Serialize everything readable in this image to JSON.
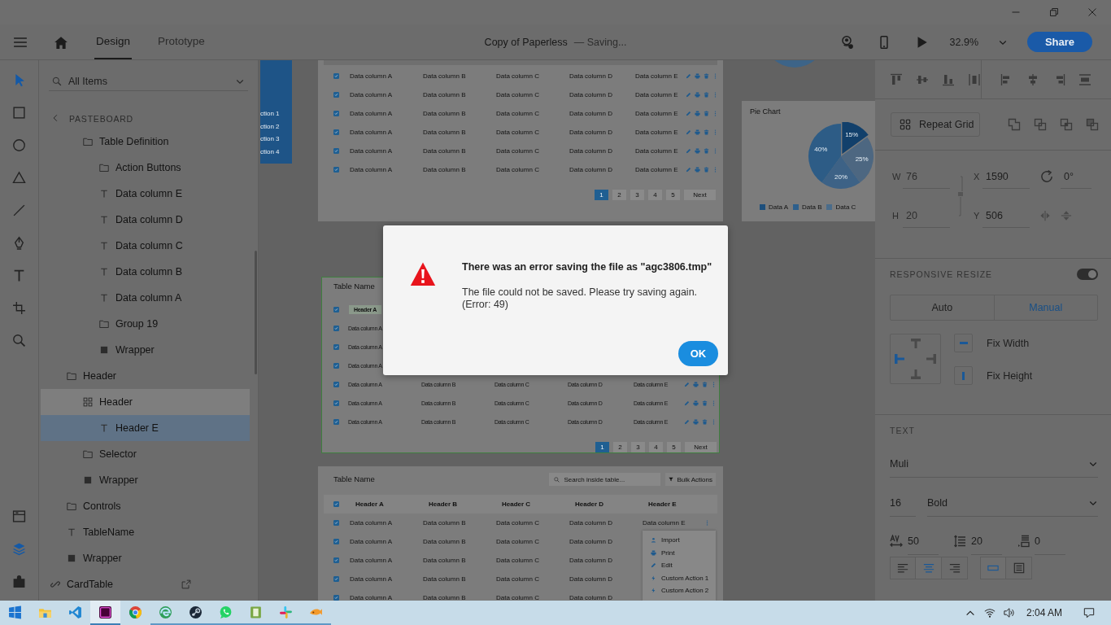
{
  "window": {
    "controls": [
      {
        "kind": "minimize"
      },
      {
        "kind": "restore"
      },
      {
        "kind": "close"
      }
    ]
  },
  "toolbar": {
    "tabs": [
      {
        "label": "Design",
        "selected": true
      },
      {
        "label": "Prototype",
        "selected": false
      }
    ],
    "document_title": "Copy of Paperless",
    "save_status": "— Saving...",
    "zoom": "32.9%",
    "share": "Share"
  },
  "tools": [
    {
      "kind": "select",
      "selected": true
    },
    {
      "kind": "rectangle",
      "selected": false
    },
    {
      "kind": "ellipse",
      "selected": false
    },
    {
      "kind": "polygon",
      "selected": false
    },
    {
      "kind": "line",
      "selected": false
    },
    {
      "kind": "pen",
      "selected": false
    },
    {
      "kind": "text",
      "selected": false
    },
    {
      "kind": "artboard",
      "selected": false
    },
    {
      "kind": "zoom",
      "selected": false
    }
  ],
  "panel_switch": [
    {
      "kind": "assets",
      "selected": false
    },
    {
      "kind": "layers",
      "selected": true
    },
    {
      "kind": "plugins",
      "selected": false
    }
  ],
  "layers": {
    "filter": {
      "placeholder": "All Items"
    },
    "breadcrumb": "PASTEBOARD",
    "tree": [
      {
        "children": [
          {
            "children": [
              {
                "label": "Table Definition",
                "kind": "folder",
                "selected": false,
                "hovered": false,
                "children": [
                  {
                    "label": "Action Buttons",
                    "kind": "folder",
                    "selected": false,
                    "hovered": false
                  },
                  {
                    "label": "Data column E",
                    "kind": "text",
                    "selected": false,
                    "hovered": false
                  },
                  {
                    "label": "Data column D",
                    "kind": "text",
                    "selected": false,
                    "hovered": false
                  },
                  {
                    "label": "Data column C",
                    "kind": "text",
                    "selected": false,
                    "hovered": false
                  },
                  {
                    "label": "Data column B",
                    "kind": "text",
                    "selected": false,
                    "hovered": false
                  },
                  {
                    "label": "Data column A",
                    "kind": "text",
                    "selected": false,
                    "hovered": false
                  },
                  {
                    "label": "Group 19",
                    "kind": "folder",
                    "selected": false,
                    "hovered": false
                  },
                  {
                    "label": "Wrapper",
                    "kind": "shape",
                    "selected": false,
                    "hovered": false
                  }
                ]
              }
            ]
          },
          {
            "label": "Header",
            "kind": "folder",
            "selected": false,
            "hovered": false,
            "children": [
              {
                "label": "Header",
                "kind": "grid",
                "selected": false,
                "hovered": true,
                "children": [
                  {
                    "label": "Header E",
                    "kind": "text",
                    "selected": true,
                    "hovered": false
                  }
                ]
              },
              {
                "label": "Selector",
                "kind": "folder",
                "selected": false,
                "hovered": false
              },
              {
                "label": "Wrapper",
                "kind": "shape",
                "selected": false,
                "hovered": false
              }
            ]
          },
          {
            "label": "Controls",
            "kind": "folder",
            "selected": false,
            "hovered": false
          },
          {
            "label": "TableName",
            "kind": "text",
            "selected": false,
            "hovered": false
          },
          {
            "label": "Wrapper",
            "kind": "shape",
            "selected": false,
            "hovered": false
          }
        ]
      },
      {
        "label": "CardTable",
        "kind": "component",
        "selected": false,
        "hovered": false,
        "linked": true
      }
    ]
  },
  "canvas": {
    "nav_artboard": {
      "items": [
        "ction 1",
        "ction 2",
        "ction 3",
        "ction 4"
      ]
    },
    "tables": [
      {
        "frame_selected": false,
        "rows": [
          {
            "kind": "actions",
            "checked": true,
            "cells": [
              "Data column A",
              "Data column B",
              "Data column C",
              "Data column D",
              "Data column E"
            ]
          },
          {
            "kind": "actions",
            "checked": true,
            "cells": [
              "Data column A",
              "Data column B",
              "Data column C",
              "Data column D",
              "Data column E"
            ]
          },
          {
            "kind": "actions",
            "checked": true,
            "cells": [
              "Data column A",
              "Data column B",
              "Data column C",
              "Data column D",
              "Data column E"
            ]
          },
          {
            "kind": "actions",
            "checked": true,
            "cells": [
              "Data column A",
              "Data column B",
              "Data column C",
              "Data column D",
              "Data column E"
            ]
          },
          {
            "kind": "actions",
            "checked": true,
            "cells": [
              "Data column A",
              "Data column B",
              "Data column C",
              "Data column D",
              "Data column E"
            ]
          },
          {
            "kind": "actions",
            "checked": true,
            "cells": [
              "Data column A",
              "Data column B",
              "Data column C",
              "Data column D",
              "Data column E"
            ]
          }
        ],
        "pagination": {
          "pages": [
            {
              "label": "1",
              "selected": true
            },
            {
              "label": "2",
              "selected": false
            },
            {
              "label": "3",
              "selected": false
            },
            {
              "label": "4",
              "selected": false
            },
            {
              "label": "5",
              "selected": false
            }
          ],
          "next": "Next"
        }
      },
      {
        "title": "Table Name",
        "frame_selected": true,
        "header": {
          "checked": true,
          "cells": [
            {
              "label": "Header A",
              "highlighted": true
            }
          ]
        },
        "rows": [
          {
            "kind": "plain",
            "checked": true,
            "cells": [
              "Data column A"
            ]
          },
          {
            "kind": "plain",
            "checked": true,
            "cells": [
              "Data column A"
            ]
          },
          {
            "kind": "plain",
            "checked": true,
            "cells": [
              "Data column A"
            ]
          },
          {
            "kind": "actions",
            "checked": true,
            "cells": [
              "Data column A",
              "Data column B",
              "Data column C",
              "Data column D",
              "Data column E"
            ]
          },
          {
            "kind": "actions",
            "checked": true,
            "cells": [
              "Data column A",
              "Data column B",
              "Data column C",
              "Data column D",
              "Data column E"
            ]
          },
          {
            "kind": "actions",
            "checked": true,
            "cells": [
              "Data column A",
              "Data column B",
              "Data column C",
              "Data column D",
              "Data column E"
            ]
          }
        ],
        "pagination": {
          "pages": [
            {
              "label": "1",
              "selected": true
            },
            {
              "label": "2",
              "selected": false
            },
            {
              "label": "3",
              "selected": false
            },
            {
              "label": "4",
              "selected": false
            },
            {
              "label": "5",
              "selected": false
            }
          ],
          "next": "Next"
        }
      },
      {
        "title": "Table Name",
        "frame_selected": false,
        "search": {
          "placeholder": "Search inside table..."
        },
        "bulk_actions": "Bulk Actions",
        "header": {
          "checked": true,
          "cells": [
            {
              "label": "Header A",
              "highlighted": false
            },
            {
              "label": "Header B",
              "highlighted": false
            },
            {
              "label": "Header C",
              "highlighted": false
            },
            {
              "label": "Header D",
              "highlighted": false
            },
            {
              "label": "Header E",
              "highlighted": false
            }
          ]
        },
        "rows": [
          {
            "kind": "menu",
            "checked": true,
            "cells": [
              "Data column A",
              "Data column B",
              "Data column C",
              "Data column D",
              "Data column E"
            ]
          },
          {
            "kind": "plain",
            "checked": true,
            "cells": [
              "Data column A",
              "Data column B",
              "Data column C",
              "Data column D"
            ]
          },
          {
            "kind": "plain",
            "checked": true,
            "cells": [
              "Data column A",
              "Data column B",
              "Data column C",
              "Data column D"
            ]
          },
          {
            "kind": "plain",
            "checked": true,
            "cells": [
              "Data column A",
              "Data column B",
              "Data column C",
              "Data column D"
            ]
          },
          {
            "kind": "plain",
            "checked": true,
            "cells": [
              "Data column A",
              "Data column B",
              "Data column C",
              "Data column D"
            ]
          }
        ],
        "menu": [
          {
            "kind": "import",
            "label": "Import"
          },
          {
            "kind": "print",
            "label": "Print"
          },
          {
            "kind": "edit",
            "label": "Edit"
          },
          {
            "kind": "custom",
            "label": "Custom Action 1"
          },
          {
            "kind": "custom",
            "label": "Custom Action 2"
          }
        ]
      }
    ],
    "pie_card": {
      "chart_data": {
        "type": "pie",
        "title": "Pie Chart",
        "values": [
          15,
          25,
          20,
          40
        ],
        "value_labels": [
          "15%",
          "25%",
          "20%",
          "40%"
        ]
      },
      "legend": [
        {
          "label": "Data A",
          "color": "#1d4f7c"
        },
        {
          "label": "Data B",
          "color": "#2d5f8c"
        },
        {
          "label": "Data C",
          "color": "#4a6c8a"
        }
      ]
    }
  },
  "properties": {
    "repeat_grid": "Repeat Grid",
    "transform": {
      "w": {
        "label": "W",
        "value": "76"
      },
      "x": {
        "label": "X",
        "value": "1590"
      },
      "rotation": "0°",
      "h": {
        "label": "H",
        "value": "20"
      },
      "y": {
        "label": "Y",
        "value": "506"
      }
    },
    "responsive_resize": {
      "label": "RESPONSIVE RESIZE",
      "on": true,
      "modes": [
        {
          "label": "Auto",
          "selected": false
        },
        {
          "label": "Manual",
          "selected": true
        }
      ],
      "constraints": {
        "top": false,
        "left": true,
        "right": false,
        "bottom": false
      },
      "fixes": [
        {
          "kind": "width",
          "label": "Fix Width",
          "checked": true
        },
        {
          "kind": "height",
          "label": "Fix Height",
          "checked": true
        }
      ]
    },
    "text": {
      "label": "TEXT",
      "font": "Muli",
      "size": "16",
      "weight": "Bold",
      "char_spacing": "50",
      "line_spacing": "20",
      "paragraph_spacing": "0",
      "align": [
        {
          "kind": "left",
          "selected": false
        },
        {
          "kind": "center",
          "selected": true
        },
        {
          "kind": "right",
          "selected": false
        }
      ],
      "box_modes": [
        {
          "kind": "auto-width",
          "selected": true
        },
        {
          "kind": "fixed",
          "selected": false
        }
      ]
    }
  },
  "dialog": {
    "title": "There was an error saving the file as \"agc3806.tmp\"",
    "message": "The file could not be saved. Please try saving again.",
    "error": "(Error: 49)",
    "button": "OK"
  },
  "taskbar": {
    "apps": [
      {
        "kind": "files",
        "running": false,
        "active": false
      },
      {
        "kind": "code",
        "running": false,
        "active": false
      },
      {
        "kind": "design",
        "running": true,
        "active": true
      },
      {
        "kind": "browser",
        "running": false,
        "active": false
      },
      {
        "kind": "browser2",
        "running": true,
        "active": false
      },
      {
        "kind": "game",
        "running": true,
        "active": false
      },
      {
        "kind": "chat",
        "running": true,
        "active": false
      },
      {
        "kind": "notes",
        "running": true,
        "active": false
      },
      {
        "kind": "team",
        "running": true,
        "active": false
      },
      {
        "kind": "fish",
        "running": true,
        "active": false
      }
    ],
    "time": "2:04 AM"
  }
}
